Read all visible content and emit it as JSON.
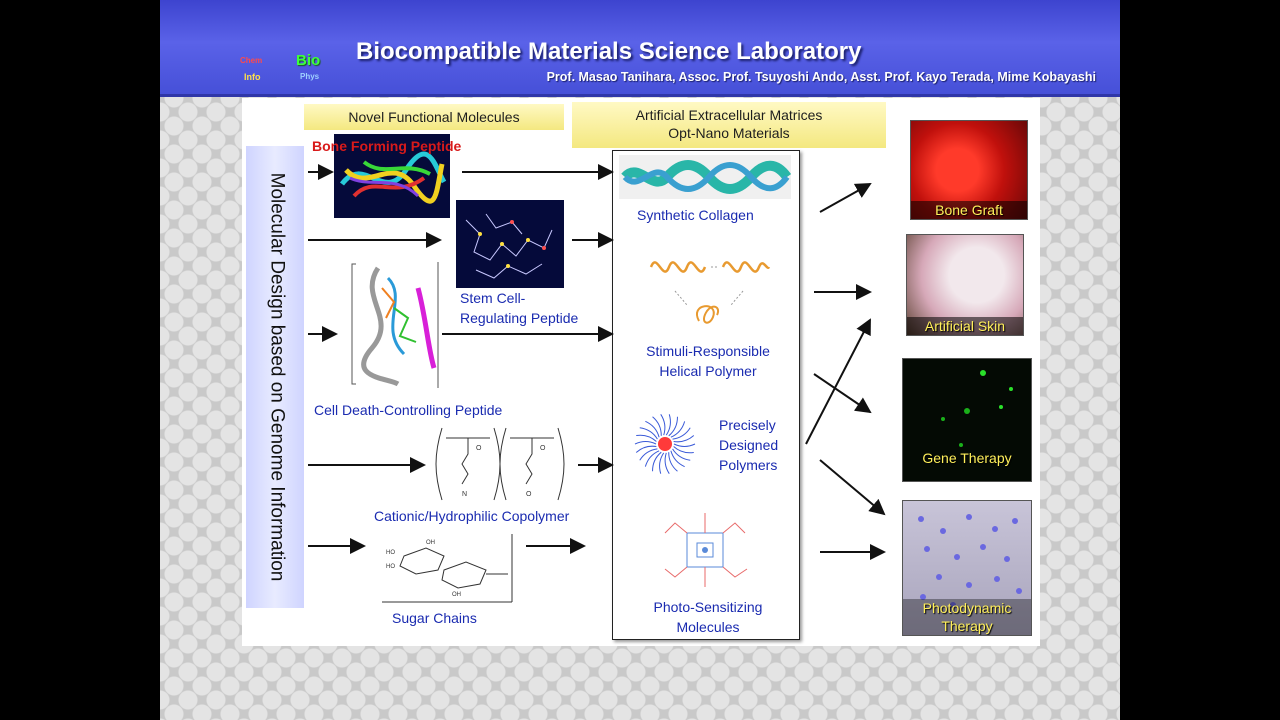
{
  "header": {
    "title": "Biocompatible Materials Science Laboratory",
    "authors": "Prof. Masao Tanihara, Assoc. Prof. Tsuyoshi Ando, Asst. Prof.  Kayo Terada, Mime Kobayashi",
    "logo": {
      "chem": "Chem",
      "info": "Info",
      "bio": "Bio",
      "phys": "Phys"
    }
  },
  "columns": {
    "novel_header": "Novel Functional Molecules",
    "ecm_header_line1": "Artificial Extracellular Matrices",
    "ecm_header_line2": "Opt-Nano Materials"
  },
  "genome_label": "Molecular Design based on Genome Information",
  "molecules": {
    "bone_forming": "Bone Forming Peptide",
    "stem_cell_line1": "Stem Cell-",
    "stem_cell_line2": "Regulating Peptide",
    "cell_death": "Cell Death-Controlling Peptide",
    "cationic": "Cationic/Hydrophilic Copolymer",
    "sugar": "Sugar Chains"
  },
  "materials": {
    "collagen": "Synthetic Collagen",
    "helical_line1": "Stimuli-Responsible",
    "helical_line2": "Helical Polymer",
    "precise_line1": "Precisely",
    "precise_line2": "Designed",
    "precise_line3": "Polymers",
    "photo_line1": "Photo-Sensitizing",
    "photo_line2": "Molecules"
  },
  "applications": {
    "bone_graft": "Bone Graft",
    "artificial_skin": "Artificial Skin",
    "gene_therapy": "Gene Therapy",
    "photodynamic_line1": "Photodynamic",
    "photodynamic_line2": "Therapy"
  },
  "colors": {
    "header_blue": "#4a52dc",
    "label_blue": "#1a2bb0",
    "label_red": "#d81a1a",
    "caption_yellow": "#ffef5a",
    "header_box_yellow": "#f8ee9a"
  }
}
